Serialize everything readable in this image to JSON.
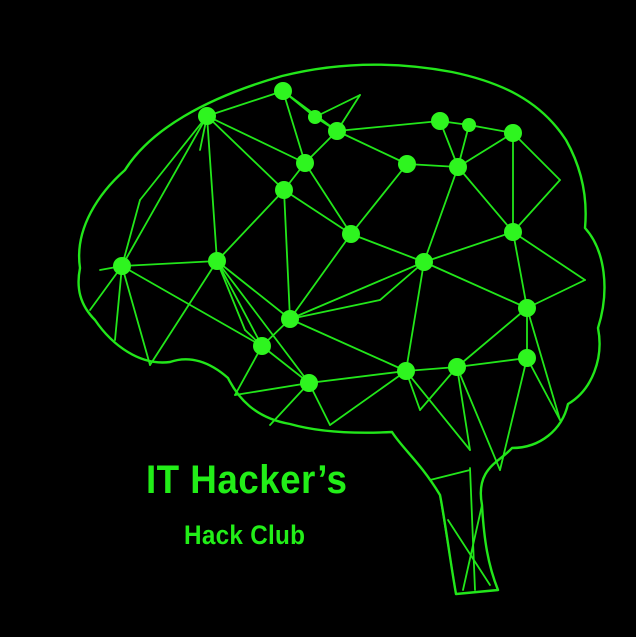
{
  "logo": {
    "icon": "brain-network-icon",
    "title": "IT Hacker’s",
    "subtitle": "Hack Club"
  },
  "colors": {
    "background": "#000000",
    "accent": "#22e61a",
    "node": "#2ef51f"
  }
}
